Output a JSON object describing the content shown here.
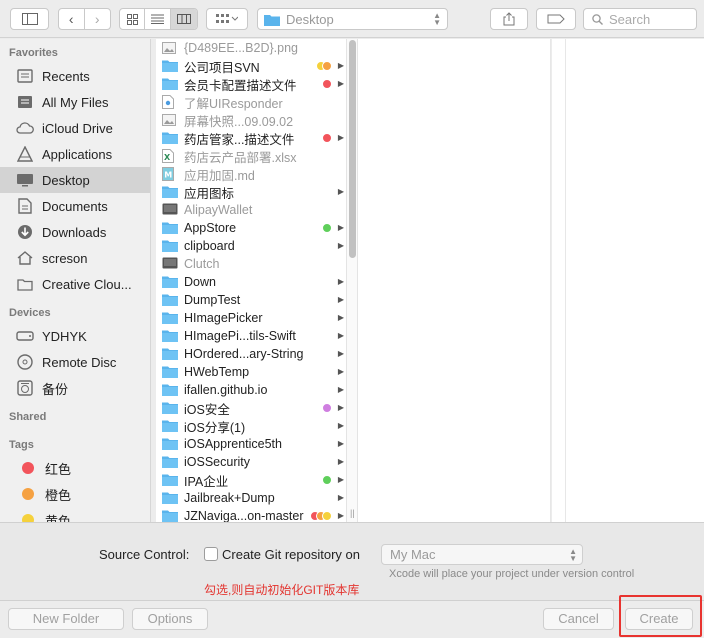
{
  "toolbar": {
    "location": "Desktop",
    "search_placeholder": "Search"
  },
  "sidebar": {
    "sections": {
      "favorites": "Favorites",
      "devices": "Devices",
      "shared": "Shared",
      "tags": "Tags"
    },
    "favorites": [
      {
        "label": "Recents",
        "icon": "recents-icon"
      },
      {
        "label": "All My Files",
        "icon": "all-files-icon"
      },
      {
        "label": "iCloud Drive",
        "icon": "cloud-icon"
      },
      {
        "label": "Applications",
        "icon": "applications-icon"
      },
      {
        "label": "Desktop",
        "icon": "desktop-icon",
        "selected": true
      },
      {
        "label": "Documents",
        "icon": "documents-icon"
      },
      {
        "label": "Downloads",
        "icon": "downloads-icon"
      },
      {
        "label": "screson",
        "icon": "home-icon"
      },
      {
        "label": "Creative Clou...",
        "icon": "folder-icon"
      }
    ],
    "devices": [
      {
        "label": "YDHYK",
        "icon": "disk-icon"
      },
      {
        "label": "Remote Disc",
        "icon": "remote-disc-icon"
      },
      {
        "label": "备份",
        "icon": "backup-disk-icon"
      }
    ],
    "tags": [
      {
        "label": "红色",
        "color": "#f2545b"
      },
      {
        "label": "橙色",
        "color": "#f5a142"
      },
      {
        "label": "黄色",
        "color": "#f5d13c"
      }
    ]
  },
  "files": [
    {
      "name": "{D489EE...B2D}.png",
      "type": "image",
      "dim": true,
      "tags": [],
      "folder": false
    },
    {
      "name": "公司项目SVN",
      "type": "folder",
      "dim": false,
      "tags": [
        "#f5d13c",
        "#f5a142"
      ],
      "folder": true
    },
    {
      "name": "会员卡配置描述文件",
      "type": "folder",
      "dim": false,
      "tags": [
        "#f2545b"
      ],
      "folder": true
    },
    {
      "name": "了解UIResponder",
      "type": "doc",
      "dim": true,
      "tags": [],
      "folder": false
    },
    {
      "name": "屏幕快照...09.09.02",
      "type": "image",
      "dim": true,
      "tags": [],
      "folder": false
    },
    {
      "name": "药店管家...描述文件",
      "type": "folder",
      "dim": false,
      "tags": [
        "#f2545b"
      ],
      "folder": true
    },
    {
      "name": "药店云产品部署.xlsx",
      "type": "excel",
      "dim": true,
      "tags": [],
      "folder": false
    },
    {
      "name": "应用加固.md",
      "type": "md",
      "dim": true,
      "tags": [],
      "folder": false
    },
    {
      "name": "应用图标",
      "type": "folder",
      "dim": false,
      "tags": [],
      "folder": true
    },
    {
      "name": "AlipayWallet",
      "type": "app",
      "dim": true,
      "tags": [],
      "folder": false
    },
    {
      "name": "AppStore",
      "type": "folder",
      "dim": false,
      "tags": [
        "#5fcf5b"
      ],
      "folder": true
    },
    {
      "name": "clipboard",
      "type": "folder",
      "dim": false,
      "tags": [],
      "folder": true
    },
    {
      "name": "Clutch",
      "type": "app",
      "dim": true,
      "tags": [],
      "folder": false
    },
    {
      "name": "Down",
      "type": "folder",
      "dim": false,
      "tags": [],
      "folder": true
    },
    {
      "name": "DumpTest",
      "type": "folder",
      "dim": false,
      "tags": [],
      "folder": true
    },
    {
      "name": "HImagePicker",
      "type": "folder",
      "dim": false,
      "tags": [],
      "folder": true
    },
    {
      "name": "HImagePi...tils-Swift",
      "type": "folder",
      "dim": false,
      "tags": [],
      "folder": true
    },
    {
      "name": "HOrdered...ary-String",
      "type": "folder",
      "dim": false,
      "tags": [],
      "folder": true
    },
    {
      "name": "HWebTemp",
      "type": "folder",
      "dim": false,
      "tags": [],
      "folder": true
    },
    {
      "name": "ifallen.github.io",
      "type": "folder",
      "dim": false,
      "tags": [],
      "folder": true
    },
    {
      "name": "iOS安全",
      "type": "folder",
      "dim": false,
      "tags": [
        "#cf7ee0"
      ],
      "folder": true
    },
    {
      "name": "iOS分享(1)",
      "type": "folder",
      "dim": false,
      "tags": [],
      "folder": true
    },
    {
      "name": "iOSApprentice5th",
      "type": "folder",
      "dim": false,
      "tags": [],
      "folder": true
    },
    {
      "name": "iOSSecurity",
      "type": "folder",
      "dim": false,
      "tags": [],
      "folder": true
    },
    {
      "name": "IPA企业",
      "type": "folder",
      "dim": false,
      "tags": [
        "#5fcf5b"
      ],
      "folder": true
    },
    {
      "name": "Jailbreak+Dump",
      "type": "folder",
      "dim": false,
      "tags": [],
      "folder": true
    },
    {
      "name": "JZNaviga...on-master",
      "type": "folder",
      "dim": false,
      "tags": [
        "#f2545b",
        "#f5a142",
        "#f5d13c"
      ],
      "folder": true
    }
  ],
  "source_control": {
    "label": "Source Control:",
    "checkbox_label": "Create Git repository on",
    "checked": false,
    "location_value": "My Mac",
    "hint": "Xcode will place your project under version control",
    "annotation": "勾选,则自动初始化GIT版本库"
  },
  "buttons": {
    "new_folder": "New Folder",
    "options": "Options",
    "cancel": "Cancel",
    "create": "Create"
  },
  "colors": {
    "folder": "#5ab4ec",
    "annotation_red": "#e3342f",
    "selection": "#d3d3d3"
  }
}
